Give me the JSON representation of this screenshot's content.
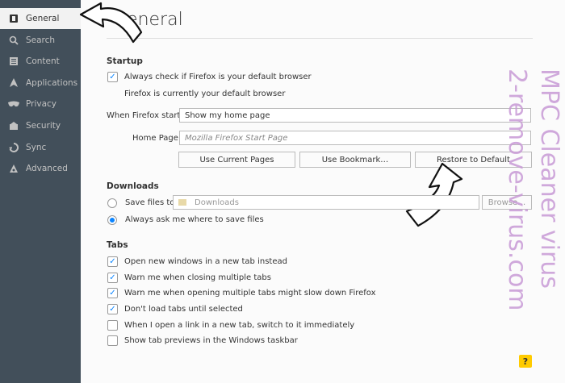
{
  "sidebar": {
    "items": [
      {
        "label": "General",
        "icon": "general-icon",
        "selected": true
      },
      {
        "label": "Search",
        "icon": "search-icon",
        "selected": false
      },
      {
        "label": "Content",
        "icon": "content-icon",
        "selected": false
      },
      {
        "label": "Applications",
        "icon": "applications-icon",
        "selected": false
      },
      {
        "label": "Privacy",
        "icon": "privacy-icon",
        "selected": false
      },
      {
        "label": "Security",
        "icon": "security-icon",
        "selected": false
      },
      {
        "label": "Sync",
        "icon": "sync-icon",
        "selected": false
      },
      {
        "label": "Advanced",
        "icon": "advanced-icon",
        "selected": false
      }
    ]
  },
  "page": {
    "title": "General"
  },
  "startup": {
    "heading": "Startup",
    "default_check_label": "Always check if Firefox is your default browser",
    "default_check_checked": true,
    "default_status": "Firefox is currently your default browser",
    "when_starts_label": "When Firefox starts:",
    "when_starts_value": "Show my home page",
    "home_page_label": "Home Page:",
    "home_page_placeholder": "Mozilla Firefox Start Page",
    "btn_current": "Use Current Pages",
    "btn_bookmark": "Use Bookmark…",
    "btn_restore": "Restore to Default"
  },
  "downloads": {
    "heading": "Downloads",
    "save_files_label": "Save files to",
    "save_folder": "Downloads",
    "browse": "Browse…",
    "always_ask_label": "Always ask me where to save files",
    "always_ask_selected": true
  },
  "tabs": {
    "heading": "Tabs",
    "options": [
      {
        "label": "Open new windows in a new tab instead",
        "checked": true
      },
      {
        "label": "Warn me when closing multiple tabs",
        "checked": true
      },
      {
        "label": "Warn me when opening multiple tabs might slow down Firefox",
        "checked": true
      },
      {
        "label": "Don't load tabs until selected",
        "checked": true
      },
      {
        "label": "When I open a link in a new tab, switch to it immediately",
        "checked": false
      },
      {
        "label": "Show tab previews in the Windows taskbar",
        "checked": false
      }
    ]
  },
  "watermark": {
    "line1": "MPC Cleaner virus",
    "line2": "2-remove-virus.com",
    "color": "#c89ad6"
  },
  "help_label": "?",
  "colors": {
    "sidebar": "#424f5a",
    "accent": "#0a84ff",
    "help": "#ffcb00"
  }
}
